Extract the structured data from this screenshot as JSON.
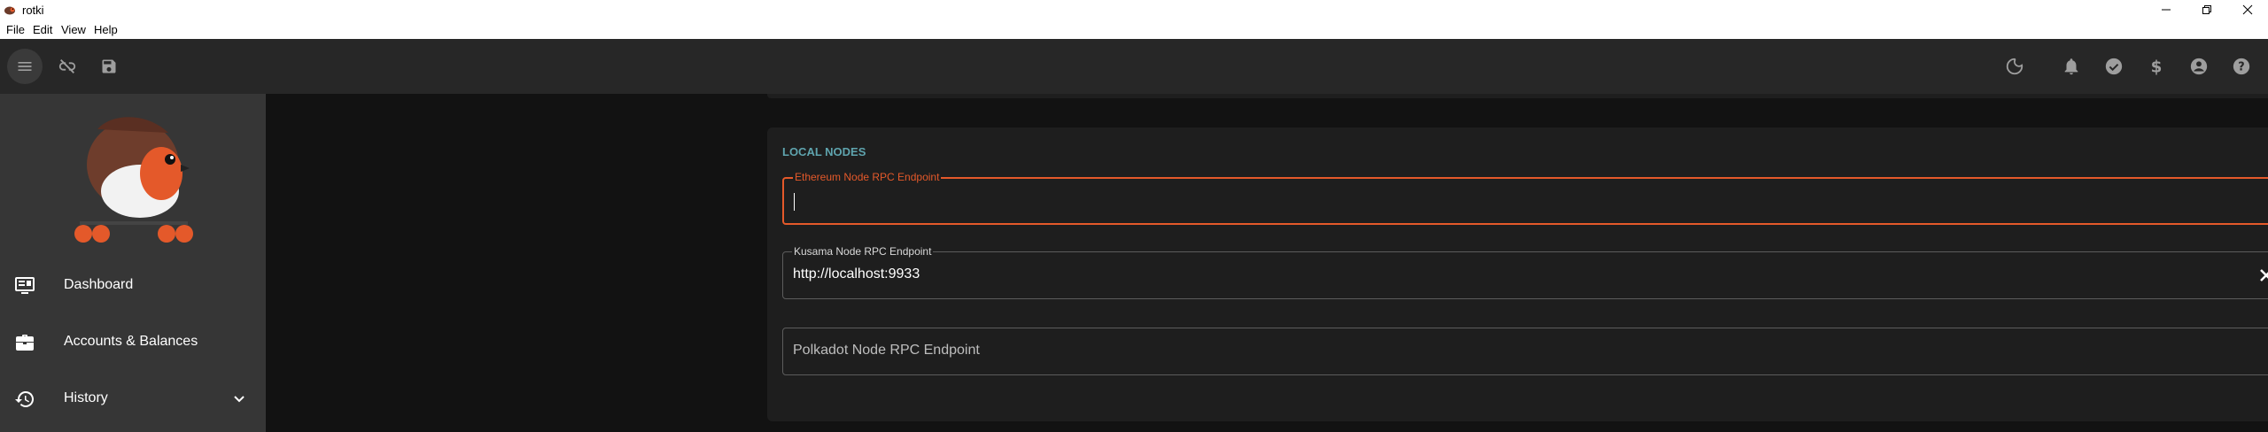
{
  "window": {
    "title": "rotki",
    "controls": {
      "minimize": "minimize-icon",
      "restore": "restore-icon",
      "close": "close-icon"
    }
  },
  "menubar": {
    "items": [
      "File",
      "Edit",
      "View",
      "Help"
    ]
  },
  "appbar": {
    "left_icons": [
      "menu-icon",
      "link-off-icon",
      "save-icon"
    ],
    "right_icons": [
      "dark-mode-icon",
      "bell-icon",
      "check-circle-icon",
      "dollar-icon",
      "account-circle-icon",
      "help-icon"
    ]
  },
  "sidebar": {
    "items": [
      {
        "label": "Dashboard",
        "icon": "dashboard-icon"
      },
      {
        "label": "Accounts & Balances",
        "icon": "briefcase-icon"
      },
      {
        "label": "History",
        "icon": "history-icon",
        "expandable": true
      }
    ]
  },
  "card": {
    "title": "LOCAL NODES",
    "fields": [
      {
        "label": "Ethereum Node RPC Endpoint",
        "value": "",
        "focused": true
      },
      {
        "label": "Kusama Node RPC Endpoint",
        "value": "http://localhost:9933",
        "clearable": true
      },
      {
        "label": "",
        "placeholder": "Polkadot Node RPC Endpoint",
        "value": ""
      }
    ]
  },
  "colors": {
    "accent_teal": "#5fa4ae",
    "focus_orange": "#e4592a",
    "appbar_bg": "#272727",
    "sidebar_bg": "#363636",
    "card_bg": "#1e1e1e",
    "main_bg": "#121212"
  }
}
